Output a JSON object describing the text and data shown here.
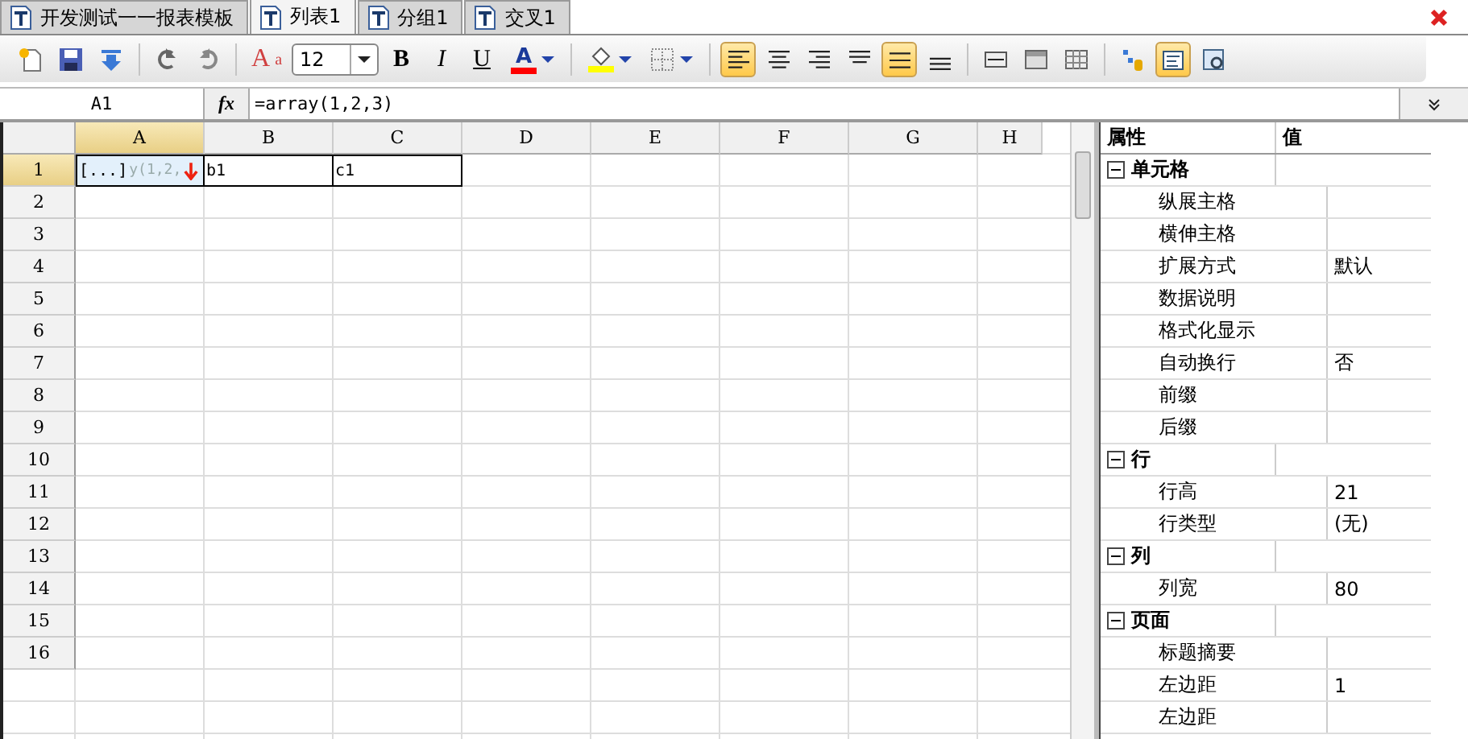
{
  "tabs": [
    {
      "label": "开发测试一一报表模板",
      "selected": false
    },
    {
      "label": "列表1",
      "selected": true
    },
    {
      "label": "分组1",
      "selected": false
    },
    {
      "label": "交叉1",
      "selected": false
    }
  ],
  "toolbar": [
    {
      "kind": "new",
      "selected": false
    },
    {
      "kind": "save",
      "selected": false
    },
    {
      "kind": "download",
      "selected": false
    },
    {
      "kind": "sep"
    },
    {
      "kind": "undo",
      "selected": false
    },
    {
      "kind": "redo",
      "selected": false
    },
    {
      "kind": "sep"
    },
    {
      "kind": "fontstyle",
      "label": "A",
      "sup": "a",
      "selected": false
    },
    {
      "kind": "fontsize",
      "value": "12"
    },
    {
      "kind": "bold",
      "label": "B",
      "selected": false
    },
    {
      "kind": "italic",
      "label": "I",
      "selected": false
    },
    {
      "kind": "underline",
      "label": "U",
      "selected": false
    },
    {
      "kind": "fontcolor",
      "label": "A",
      "color": "#ff0000"
    },
    {
      "kind": "sep"
    },
    {
      "kind": "fill",
      "color": "#ffff00"
    },
    {
      "kind": "border"
    },
    {
      "kind": "sep"
    },
    {
      "kind": "align-left",
      "selected": true
    },
    {
      "kind": "align-center",
      "selected": false
    },
    {
      "kind": "align-right",
      "selected": false
    },
    {
      "kind": "align-top",
      "selected": false
    },
    {
      "kind": "align-middle",
      "selected": true
    },
    {
      "kind": "align-bottom",
      "selected": false
    },
    {
      "kind": "sep"
    },
    {
      "kind": "merge",
      "selected": false
    },
    {
      "kind": "header",
      "selected": false
    },
    {
      "kind": "grid",
      "selected": false
    },
    {
      "kind": "sep"
    },
    {
      "kind": "datasource",
      "selected": false
    },
    {
      "kind": "properties",
      "selected": true
    },
    {
      "kind": "preview",
      "selected": false
    }
  ],
  "formula_bar": {
    "cell": "A1",
    "fx": "fx",
    "formula": "=array(1,2,3)"
  },
  "sheet": {
    "columns": [
      {
        "label": "A",
        "selected": true
      },
      {
        "label": "B",
        "selected": false
      },
      {
        "label": "C",
        "selected": false
      },
      {
        "label": "D",
        "selected": false
      },
      {
        "label": "E",
        "selected": false
      },
      {
        "label": "F",
        "selected": false
      },
      {
        "label": "G",
        "selected": false
      },
      {
        "label": "H",
        "selected": false
      }
    ],
    "rows": [
      {
        "label": "1",
        "selected": true,
        "cells": [
          {
            "value": "[...]",
            "hint": "y(1,2,",
            "expand": true
          },
          {
            "value": "b1"
          },
          {
            "value": "c1"
          }
        ]
      },
      {
        "label": "2",
        "selected": false
      },
      {
        "label": "3",
        "selected": false
      },
      {
        "label": "4",
        "selected": false
      },
      {
        "label": "5",
        "selected": false
      },
      {
        "label": "6",
        "selected": false
      },
      {
        "label": "7",
        "selected": false
      },
      {
        "label": "8",
        "selected": false
      },
      {
        "label": "9",
        "selected": false
      },
      {
        "label": "10",
        "selected": false
      },
      {
        "label": "11",
        "selected": false
      },
      {
        "label": "12",
        "selected": false
      },
      {
        "label": "13",
        "selected": false
      },
      {
        "label": "14",
        "selected": false
      },
      {
        "label": "15",
        "selected": false
      },
      {
        "label": "16",
        "selected": false
      }
    ]
  },
  "properties": {
    "columns": [
      "属性",
      "值"
    ],
    "groups": [
      {
        "name": "单元格",
        "expanded": true,
        "items": [
          {
            "name": "纵展主格"
          },
          {
            "name": "横伸主格"
          },
          {
            "name": "扩展方式",
            "value": "默认"
          },
          {
            "name": "数据说明"
          },
          {
            "name": "格式化显示"
          },
          {
            "name": "自动换行",
            "value": "否"
          },
          {
            "name": "前缀"
          },
          {
            "name": "后缀"
          }
        ]
      },
      {
        "name": "行",
        "expanded": true,
        "items": [
          {
            "name": "行高",
            "value": "21"
          },
          {
            "name": "行类型",
            "value": "(无)"
          }
        ]
      },
      {
        "name": "列",
        "expanded": true,
        "items": [
          {
            "name": "列宽",
            "value": "80"
          }
        ]
      },
      {
        "name": "页面",
        "expanded": true,
        "items": [
          {
            "name": "标题摘要"
          },
          {
            "name": "左边距",
            "value": "1"
          },
          {
            "name": "左边距"
          }
        ]
      }
    ]
  }
}
